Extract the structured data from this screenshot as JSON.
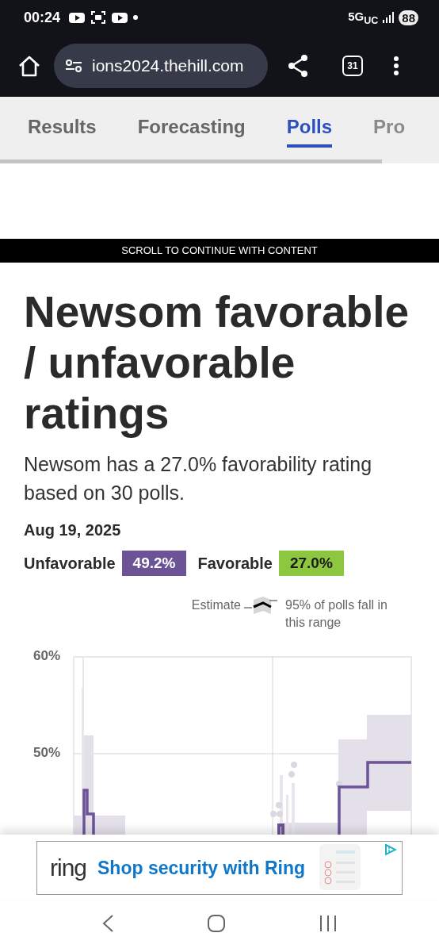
{
  "status_bar": {
    "time": "00:24",
    "network": "5G$_{UC}$",
    "battery": "88"
  },
  "browser": {
    "url": "ions2024.thehill.com",
    "tab_count": "31"
  },
  "nav_tabs": [
    {
      "label": "Results",
      "selected": false
    },
    {
      "label": "Forecasting",
      "selected": false
    },
    {
      "label": "Polls",
      "selected": true
    },
    {
      "label": "Pro",
      "selected": false
    }
  ],
  "scroll_banner": "SCROLL TO CONTINUE WITH CONTENT",
  "article": {
    "title": "Newsom favorable / unfavorable ratings",
    "summary": "Newsom has a 27.0% favorability rating based on 30 polls.",
    "date": "Aug 19, 2025",
    "ratings": [
      {
        "label": "Unfavorable",
        "value": "49.2%",
        "color": "#6b5396"
      },
      {
        "label": "Favorable",
        "value": "27.0%",
        "color": "#8dc63f"
      }
    ]
  },
  "legend": {
    "estimate": "Estimate",
    "range": "95% of polls fall in this range"
  },
  "chart": {
    "y_ticks": [
      "60%",
      "50%"
    ]
  },
  "ad": {
    "brand": "ring",
    "headline": "Shop security with Ring"
  }
}
